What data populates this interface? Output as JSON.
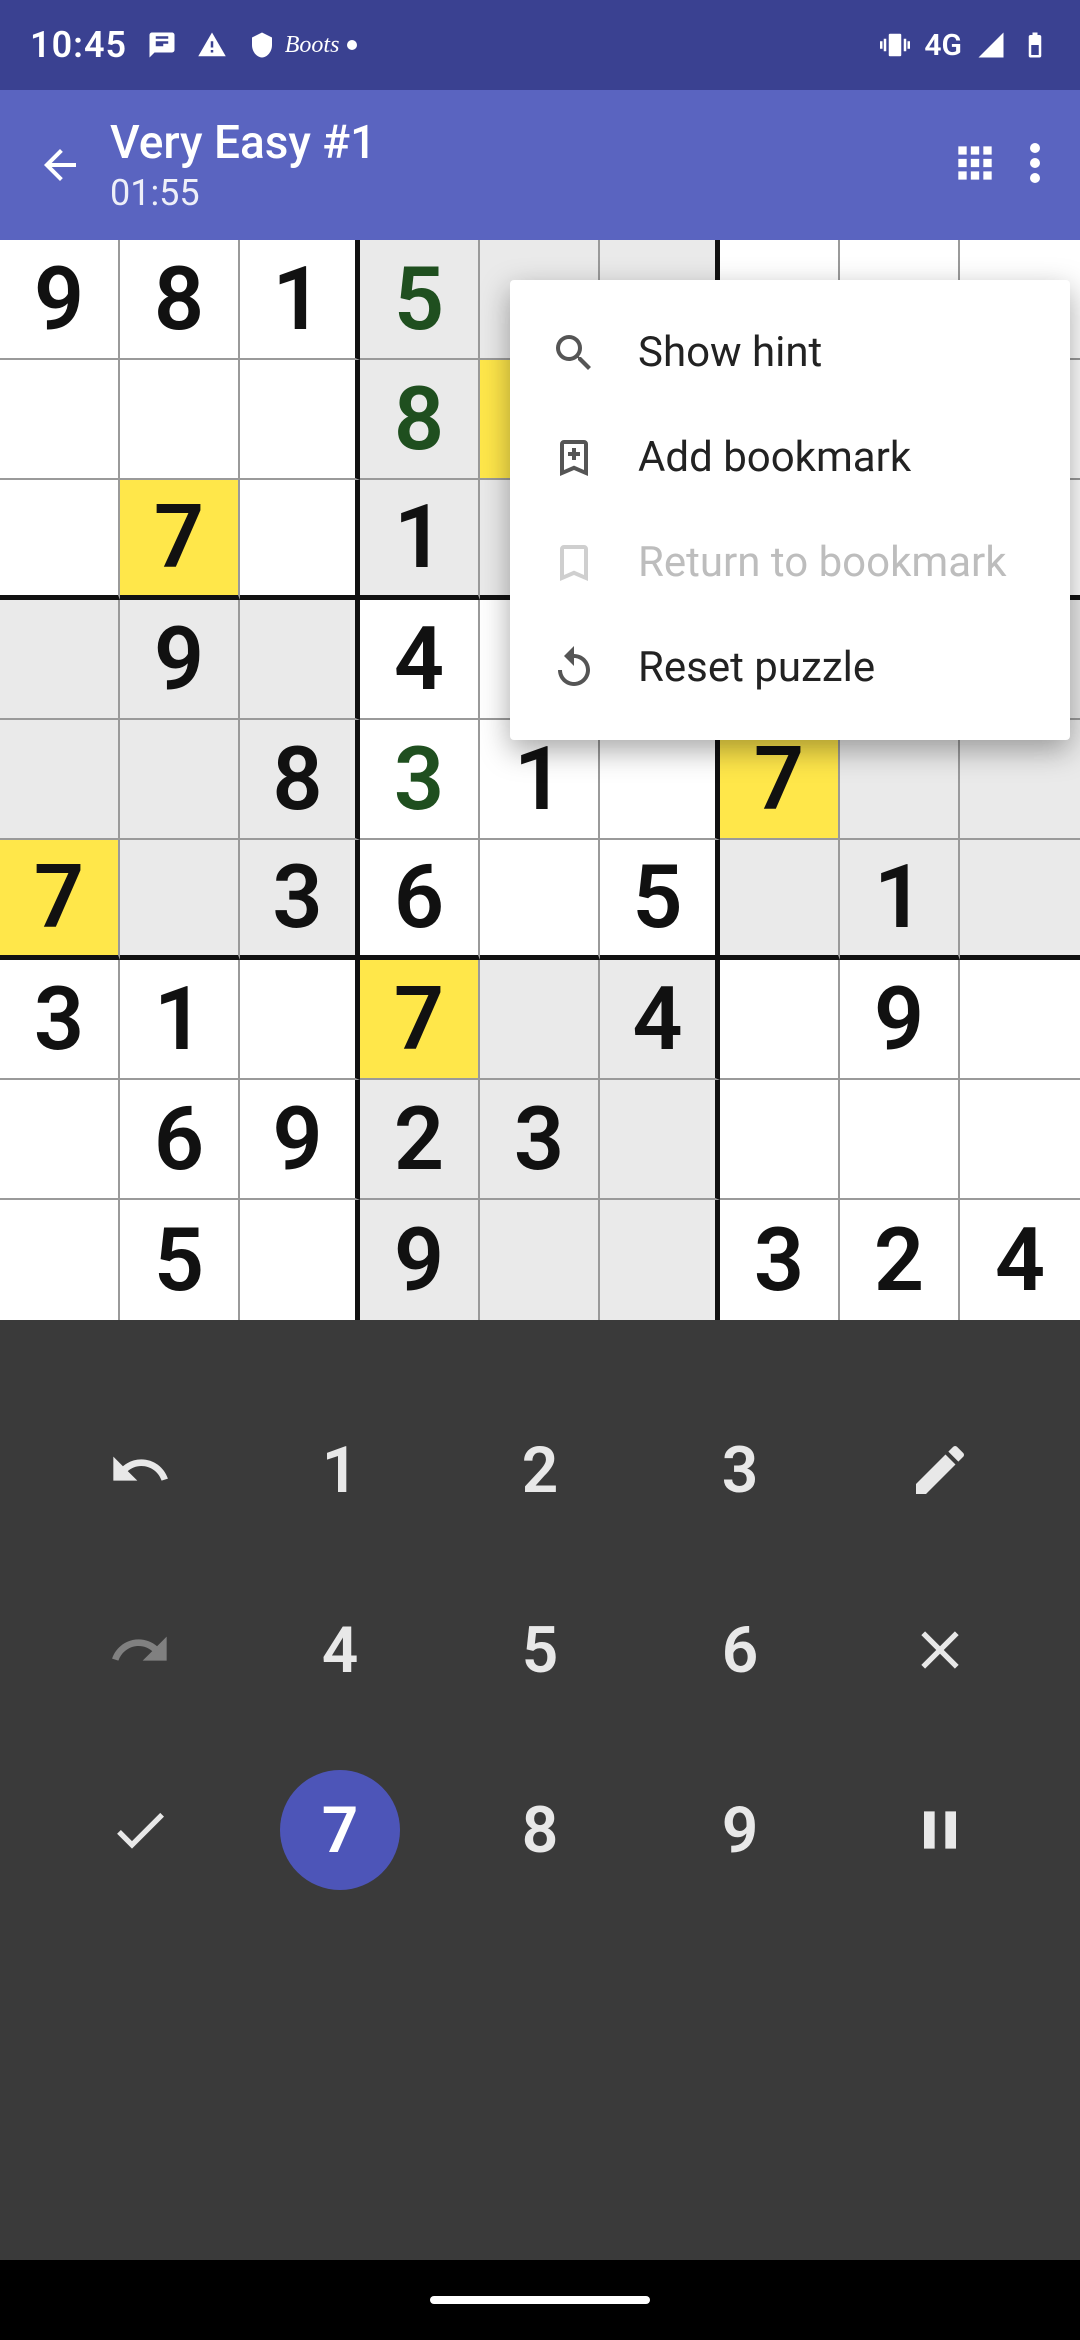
{
  "status": {
    "time": "10:45",
    "network_label": "4G"
  },
  "appbar": {
    "title": "Very Easy #1",
    "timer": "01:55"
  },
  "menu": {
    "show_hint": "Show hint",
    "add_bookmark": "Add bookmark",
    "return_bookmark": "Return to bookmark",
    "reset_puzzle": "Reset puzzle"
  },
  "board": {
    "rows": [
      [
        {
          "v": "9"
        },
        {
          "v": "8"
        },
        {
          "v": "1"
        },
        {
          "v": "5",
          "user": true,
          "shade": true
        },
        {
          "v": "",
          "shade": true
        },
        {
          "v": "",
          "shade": true
        },
        {
          "v": ""
        },
        {
          "v": ""
        },
        {
          "v": ""
        }
      ],
      [
        {
          "v": ""
        },
        {
          "v": ""
        },
        {
          "v": ""
        },
        {
          "v": "8",
          "user": true,
          "shade": true
        },
        {
          "v": "",
          "hl": true
        },
        {
          "v": "",
          "shade": true
        },
        {
          "v": ""
        },
        {
          "v": ""
        },
        {
          "v": ""
        }
      ],
      [
        {
          "v": ""
        },
        {
          "v": "7",
          "hl": true
        },
        {
          "v": ""
        },
        {
          "v": "1",
          "shade": true
        },
        {
          "v": "",
          "shade": true
        },
        {
          "v": "",
          "shade": true
        },
        {
          "v": ""
        },
        {
          "v": ""
        },
        {
          "v": ""
        }
      ],
      [
        {
          "v": "",
          "shade": true
        },
        {
          "v": "9",
          "shade": true
        },
        {
          "v": "",
          "shade": true
        },
        {
          "v": "4"
        },
        {
          "v": ""
        },
        {
          "v": ""
        },
        {
          "v": "",
          "shade": true
        },
        {
          "v": "",
          "shade": true
        },
        {
          "v": "",
          "shade": true
        }
      ],
      [
        {
          "v": "",
          "shade": true
        },
        {
          "v": "",
          "shade": true
        },
        {
          "v": "8",
          "shade": true
        },
        {
          "v": "3",
          "user": true
        },
        {
          "v": "1"
        },
        {
          "v": ""
        },
        {
          "v": "7",
          "hl": true
        },
        {
          "v": "",
          "shade": true
        },
        {
          "v": "",
          "shade": true
        }
      ],
      [
        {
          "v": "7",
          "hl": true
        },
        {
          "v": "",
          "shade": true
        },
        {
          "v": "3",
          "shade": true
        },
        {
          "v": "6"
        },
        {
          "v": ""
        },
        {
          "v": "5"
        },
        {
          "v": "",
          "shade": true
        },
        {
          "v": "1",
          "shade": true
        },
        {
          "v": "",
          "shade": true
        }
      ],
      [
        {
          "v": "3"
        },
        {
          "v": "1"
        },
        {
          "v": ""
        },
        {
          "v": "7",
          "hl": true
        },
        {
          "v": "",
          "shade": true
        },
        {
          "v": "4",
          "shade": true
        },
        {
          "v": ""
        },
        {
          "v": "9"
        },
        {
          "v": ""
        }
      ],
      [
        {
          "v": ""
        },
        {
          "v": "6"
        },
        {
          "v": "9"
        },
        {
          "v": "2",
          "shade": true
        },
        {
          "v": "3",
          "shade": true
        },
        {
          "v": "",
          "shade": true
        },
        {
          "v": ""
        },
        {
          "v": ""
        },
        {
          "v": ""
        }
      ],
      [
        {
          "v": ""
        },
        {
          "v": "5"
        },
        {
          "v": ""
        },
        {
          "v": "9",
          "shade": true
        },
        {
          "v": "",
          "shade": true
        },
        {
          "v": "",
          "shade": true
        },
        {
          "v": "3"
        },
        {
          "v": "2"
        },
        {
          "v": "4"
        }
      ]
    ]
  },
  "keypad": {
    "n1": "1",
    "n2": "2",
    "n3": "3",
    "n4": "4",
    "n5": "5",
    "n6": "6",
    "n7": "7",
    "n8": "8",
    "n9": "9",
    "selected": "7"
  }
}
